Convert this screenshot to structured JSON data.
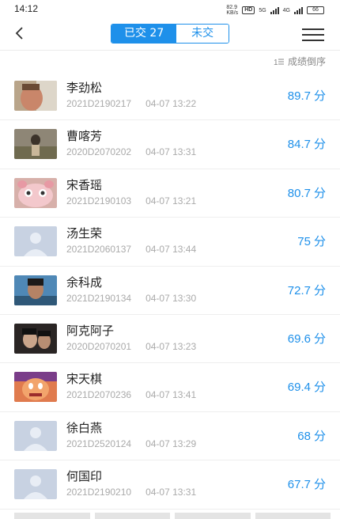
{
  "status_bar": {
    "time": "14:12",
    "speed": "82.9",
    "speed_unit": "KB/s",
    "hd": "HD",
    "net1": "5G",
    "net2": "4G",
    "battery": "66"
  },
  "nav": {
    "segment_submitted": "已交 27",
    "segment_unsubmitted": "未交",
    "accent_color": "#1e90ea"
  },
  "sort": {
    "label": "成绩倒序",
    "icon": "sort-list-icon"
  },
  "students": [
    {
      "name": "李劲松",
      "id": "2021D2190217",
      "time": "04-07 13:22",
      "score": "89.7",
      "unit": "分",
      "avatar": "photo-face"
    },
    {
      "name": "曹喀芳",
      "id": "2020D2070202",
      "time": "04-07 13:31",
      "score": "84.7",
      "unit": "分",
      "avatar": "photo-landscape"
    },
    {
      "name": "宋香瑶",
      "id": "2021D2190103",
      "time": "04-07 13:21",
      "score": "80.7",
      "unit": "分",
      "avatar": "photo-cartoon-pink"
    },
    {
      "name": "汤生荣",
      "id": "2021D2060137",
      "time": "04-07 13:44",
      "score": "75",
      "unit": "分",
      "avatar": "default"
    },
    {
      "name": "余科成",
      "id": "2021D2190134",
      "time": "04-07 13:30",
      "score": "72.7",
      "unit": "分",
      "avatar": "photo-person"
    },
    {
      "name": "阿克阿子",
      "id": "2020D2070201",
      "time": "04-07 13:23",
      "score": "69.6",
      "unit": "分",
      "avatar": "photo-dark"
    },
    {
      "name": "宋天棋",
      "id": "2021D2070236",
      "time": "04-07 13:41",
      "score": "69.4",
      "unit": "分",
      "avatar": "photo-cartoon-orange"
    },
    {
      "name": "徐白燕",
      "id": "2021D2520124",
      "time": "04-07 13:29",
      "score": "68",
      "unit": "分",
      "avatar": "default"
    },
    {
      "name": "何国印",
      "id": "2021D2190210",
      "time": "04-07 13:31",
      "score": "67.7",
      "unit": "分",
      "avatar": "default"
    }
  ]
}
